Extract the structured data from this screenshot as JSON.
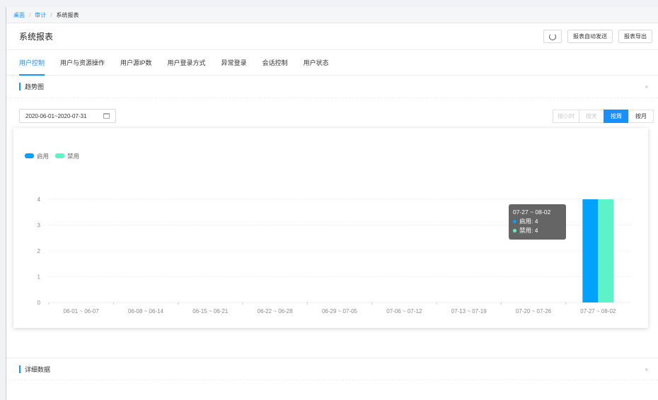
{
  "breadcrumb": [
    {
      "label": "桌面",
      "current": false
    },
    {
      "label": "审计",
      "current": false
    },
    {
      "label": "系统报表",
      "current": true
    }
  ],
  "header": {
    "title": "系统报表",
    "refresh_icon": "refresh-icon",
    "auto_send_label": "报表自动发送",
    "export_label": "报表导出"
  },
  "tabs": [
    {
      "label": "用户控制",
      "active": true
    },
    {
      "label": "用户与资源操作",
      "active": false
    },
    {
      "label": "用户源IP数",
      "active": false
    },
    {
      "label": "用户登录方式",
      "active": false
    },
    {
      "label": "异常登录",
      "active": false
    },
    {
      "label": "会话控制",
      "active": false
    },
    {
      "label": "用户状态",
      "active": false
    }
  ],
  "trend": {
    "title": "趋势图",
    "collapse_icon": "chevrons-up-icon",
    "date_range": "2020-06-01~2020-07-31",
    "calendar_icon": "calendar-icon",
    "granularity": [
      {
        "label": "按小时",
        "state": "disabled"
      },
      {
        "label": "按天",
        "state": "disabled"
      },
      {
        "label": "按周",
        "state": "active"
      },
      {
        "label": "按月",
        "state": "enabled"
      }
    ]
  },
  "tooltip": {
    "title": "07-27 ~ 08-02",
    "rows": [
      {
        "label": "启用: 4",
        "color": "#00a1ff"
      },
      {
        "label": "禁用: 4",
        "color": "#5ef2c8"
      }
    ]
  },
  "detail": {
    "title": "详细数据",
    "expand_icon": "chevrons-down-icon"
  },
  "chart_data": {
    "type": "bar",
    "categories": [
      "06-01 ~ 06-07",
      "06-08 ~ 06-14",
      "06-15 ~ 06-21",
      "06-22 ~ 06-28",
      "06-29 ~ 07-05",
      "07-06 ~ 07-12",
      "07-13 ~ 07-19",
      "07-20 ~ 07-26",
      "07-27 ~ 08-02"
    ],
    "series": [
      {
        "name": "启用",
        "color": "#00a1ff",
        "values": [
          0,
          0,
          0,
          0,
          0,
          0,
          0,
          0,
          4
        ]
      },
      {
        "name": "禁用",
        "color": "#5ef2c8",
        "values": [
          0,
          0,
          0,
          0,
          0,
          0,
          0,
          0,
          4
        ]
      }
    ],
    "yticks": [
      0,
      1,
      2,
      3,
      4
    ],
    "ylim": [
      0,
      4
    ],
    "grid": true,
    "legend": "top-left"
  }
}
